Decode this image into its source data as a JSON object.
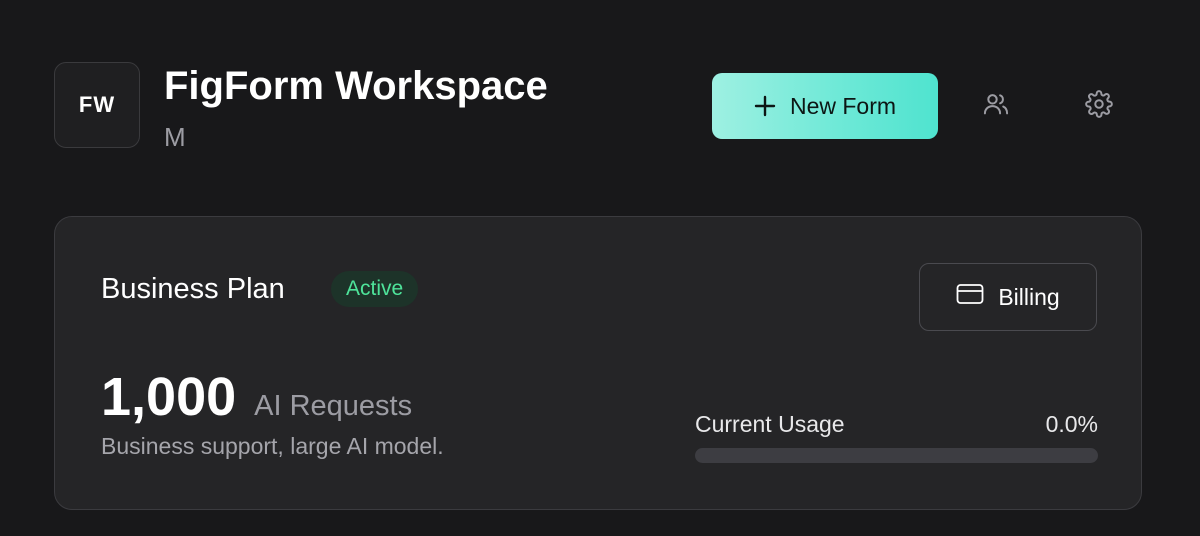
{
  "workspace": {
    "initials": "FW",
    "title": "FigForm Workspace",
    "subtitle": "M"
  },
  "header": {
    "new_form_label": "New Form",
    "icons": [
      "users-icon",
      "gear-icon"
    ]
  },
  "plan": {
    "name": "Business Plan",
    "status": "Active",
    "billing_label": "Billing",
    "request_count": "1,000",
    "request_label": "AI Requests",
    "description": "Business support, large AI model.",
    "usage_label": "Current Usage",
    "usage_value": "0.0%",
    "usage_fraction": 0.0
  },
  "colors": {
    "background": "#18181a",
    "card": "#252527",
    "accent": "#6fe9d7",
    "active_badge": "#4ee39a"
  }
}
